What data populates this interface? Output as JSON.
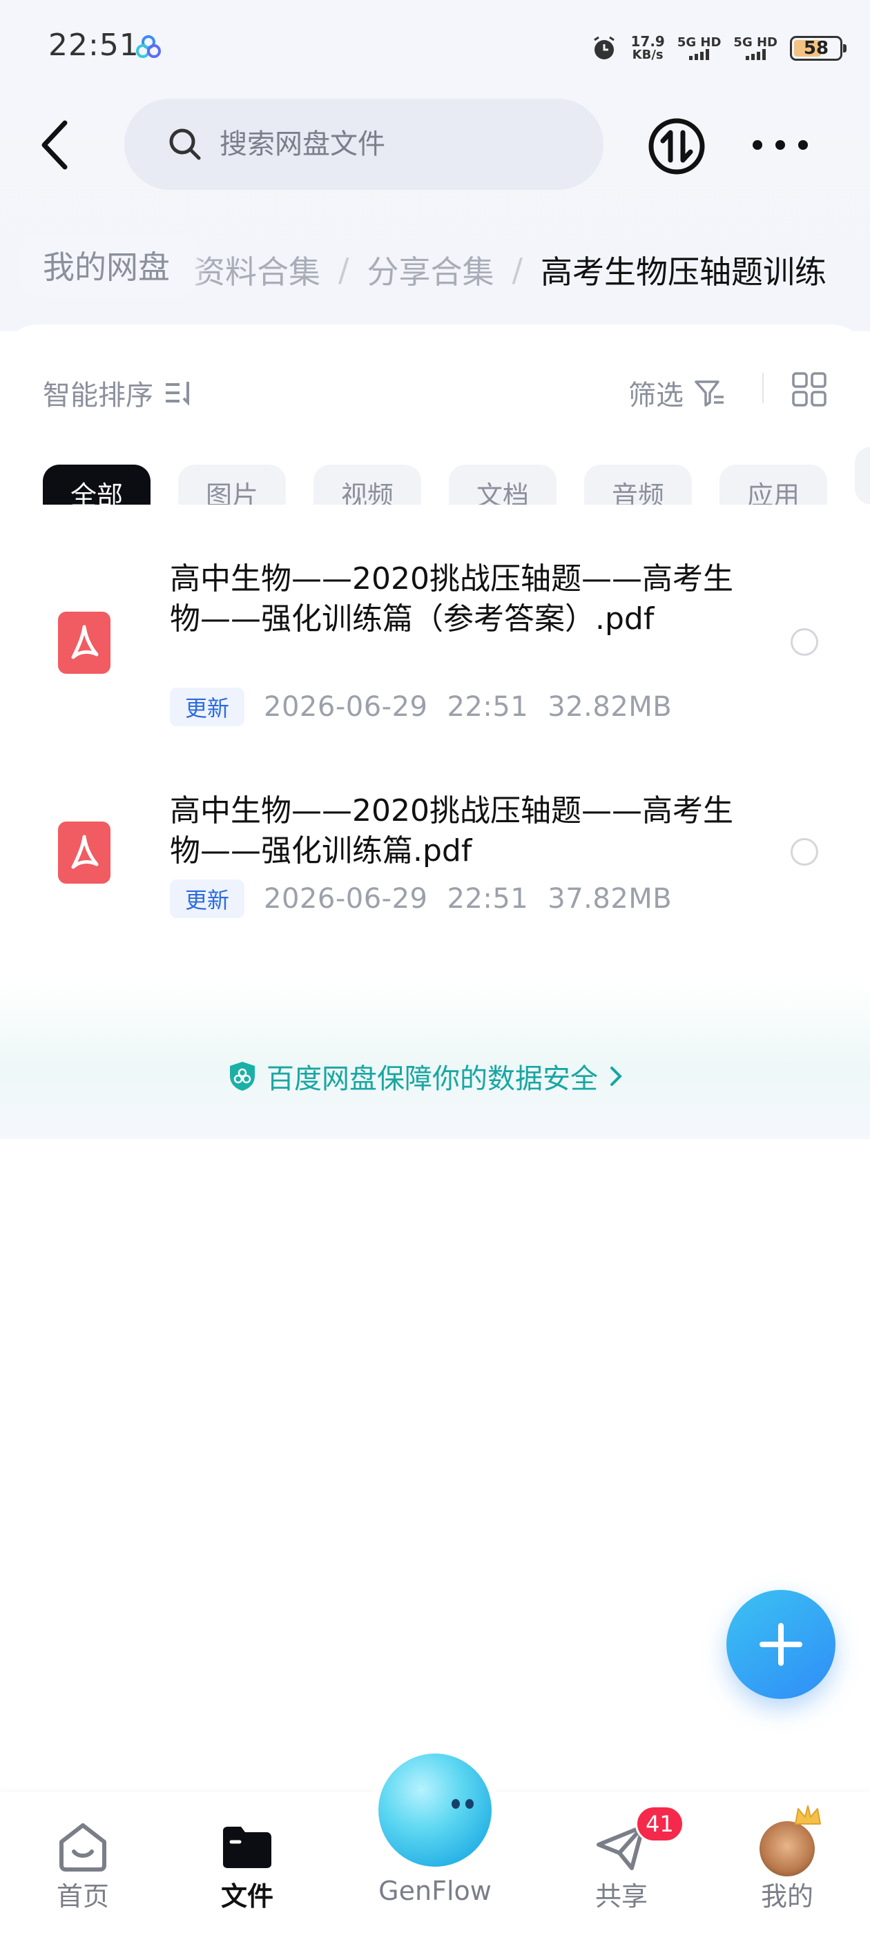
{
  "status_bar": {
    "time": "22:51",
    "net_speed_value": "17.9",
    "net_speed_unit": "KB/s",
    "sim1": "5G HD",
    "sim2": "5G HD",
    "battery": "58"
  },
  "header": {
    "search_placeholder": "搜索网盘文件"
  },
  "breadcrumb": {
    "root": "我的网盘",
    "items": [
      {
        "label": "资料合集"
      },
      {
        "label": "分享合集"
      },
      {
        "label": "高考生物压轴题训练"
      }
    ]
  },
  "toolbar": {
    "sort_label": "智能排序",
    "filter_label": "筛选"
  },
  "chips": [
    {
      "label": "全部",
      "active": true
    },
    {
      "label": "图片"
    },
    {
      "label": "视频"
    },
    {
      "label": "文档"
    },
    {
      "label": "音频"
    },
    {
      "label": "应用"
    }
  ],
  "files": [
    {
      "name": "高中生物——2020挑战压轴题——高考生物——强化训练篇（参考答案）.pdf",
      "badge": "更新",
      "date": "2026-06-29",
      "time": "22:51",
      "size": "32.82MB",
      "icon": "pdf-icon"
    },
    {
      "name": "高中生物——2020挑战压轴题——高考生物——强化训练篇.pdf",
      "badge": "更新",
      "date": "2026-06-29",
      "time": "22:51",
      "size": "37.82MB",
      "icon": "pdf-icon"
    }
  ],
  "assurance_text": "百度网盘保障你的数据安全",
  "bottom_nav": {
    "home": "首页",
    "files": "文件",
    "genflow": "GenFlow",
    "share": "共享",
    "share_badge": "41",
    "me": "我的"
  },
  "colors": {
    "accent": "#2f8df7",
    "active_chip": "#0c0d12",
    "pdf_red": "#f15b62",
    "assurance": "#19a6a2",
    "badge_red": "#f5294b"
  }
}
